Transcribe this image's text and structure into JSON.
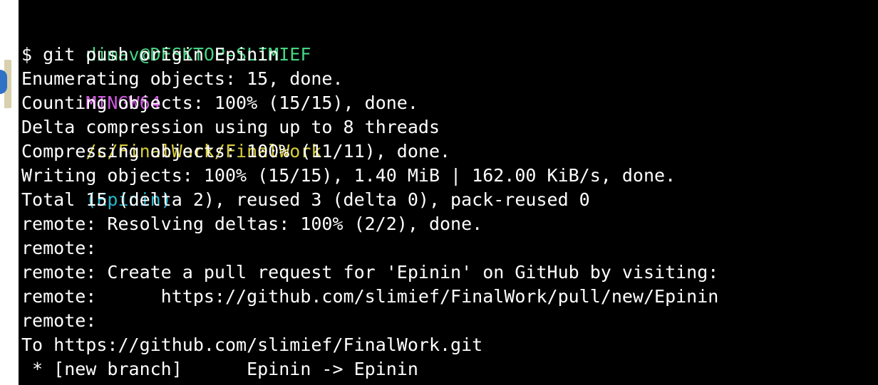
{
  "prompt": {
    "user_host": "dimav@DESKTOP-SLIMIEF",
    "system": "MINGW64",
    "path": "/c/FinalWork/FinalWork",
    "branch": "(Epinin)"
  },
  "command": "$ git push origin Epinin",
  "output_lines": [
    "Enumerating objects: 15, done.",
    "Counting objects: 100% (15/15), done.",
    "Delta compression using up to 8 threads",
    "Compressing objects: 100% (11/11), done.",
    "Writing objects: 100% (15/15), 1.40 MiB | 162.00 KiB/s, done.",
    "Total 15 (delta 2), reused 3 (delta 0), pack-reused 0",
    "remote: Resolving deltas: 100% (2/2), done.",
    "remote:",
    "remote: Create a pull request for 'Epinin' on GitHub by visiting:",
    "remote:      https://github.com/slimief/FinalWork/pull/new/Epinin",
    "remote:",
    "To https://github.com/slimief/FinalWork.git",
    " * [new branch]      Epinin -> Epinin"
  ],
  "colors": {
    "background": "#000000",
    "text": "#ffffff",
    "user": "#45d483",
    "system": "#d05adf",
    "path": "#d8ce38",
    "branch": "#27b8cf"
  }
}
